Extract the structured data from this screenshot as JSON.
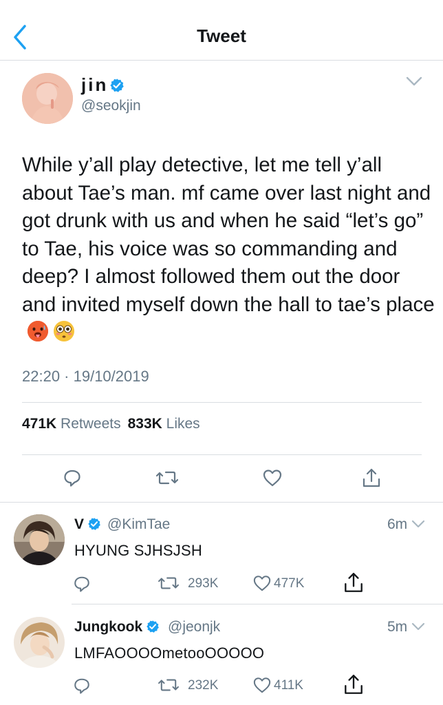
{
  "nav": {
    "title": "Tweet"
  },
  "tweet": {
    "author_name": "jin",
    "handle": "@seokjin",
    "text": "While y’all play detective, let me tell y’all about Tae’s man. mf came over last night and got drunk with us and when he said “let’s go” to Tae, his voice was so commanding and deep? I almost followed them out the door and invited myself down the hall to tae’s place",
    "emojis": [
      "hot-face-emoji",
      "flushed-face-emoji"
    ],
    "timestamp": "22:20 · 19/10/2019",
    "retweets_count": "471K",
    "retweets_label": "Retweets",
    "likes_count": "833K",
    "likes_label": "Likes"
  },
  "replies": [
    {
      "name": "V",
      "handle": "@KimTae",
      "time": "6m",
      "text": "HYUNG SJHSJSH",
      "retweets": "293K",
      "likes": "477K"
    },
    {
      "name": "Jungkook",
      "handle": "@jeonjk",
      "time": "5m",
      "text": "LMFAOOOOmetooOOOOO",
      "retweets": "232K",
      "likes": "411K"
    }
  ],
  "colors": {
    "accent": "#1da1f2",
    "text": "#14171a",
    "muted": "#657786",
    "icon": "#657786",
    "divider": "#d9dde1"
  }
}
